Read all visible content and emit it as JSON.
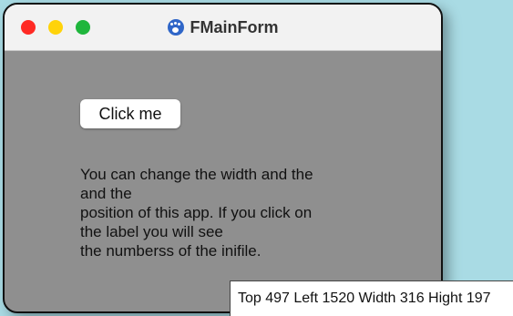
{
  "window": {
    "title": "FMainForm",
    "icon": "paw-icon",
    "traffic_lights": {
      "close": "#ff2a24",
      "minimize": "#ffd30a",
      "zoom": "#1fb63c"
    }
  },
  "button": {
    "label": "Click me"
  },
  "info_label": {
    "lines": [
      "You can change the width and the",
      "and the",
      "position of this app. If you click on",
      "the label you will see",
      "the numberss of the inifile."
    ]
  },
  "status": {
    "text": "Top 497 Left 1520 Width 316 Hight 197"
  },
  "colors": {
    "background": "#a9dbe4",
    "window_body": "#8f8f8f",
    "titlebar": "#f2f2f2"
  }
}
